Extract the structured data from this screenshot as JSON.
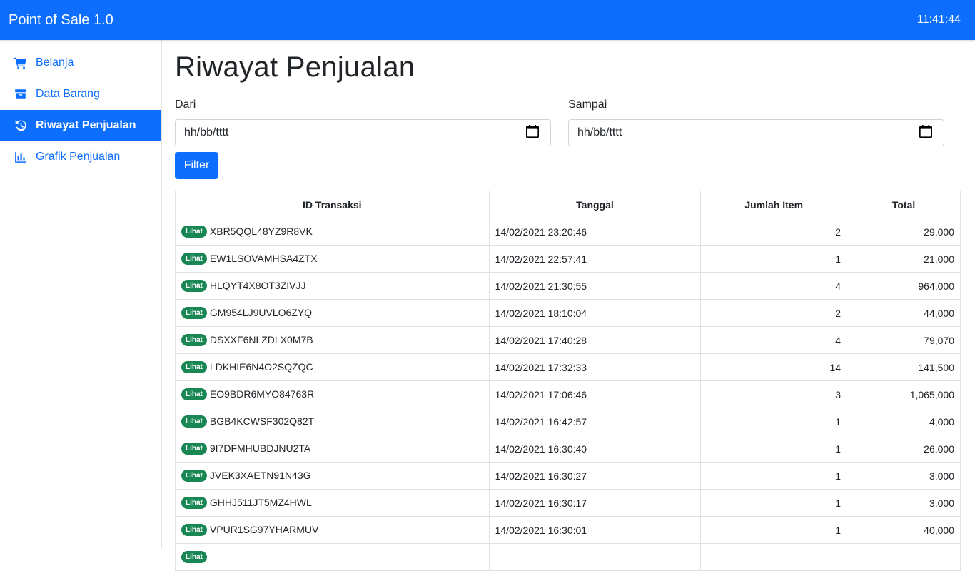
{
  "app": {
    "title": "Point of Sale 1.0",
    "clock": "11:41:44"
  },
  "sidebar": {
    "items": [
      {
        "label": "Belanja",
        "icon": "cart-icon"
      },
      {
        "label": "Data Barang",
        "icon": "archive-box-icon"
      },
      {
        "label": "Riwayat Penjualan",
        "icon": "history-icon",
        "active": true
      },
      {
        "label": "Grafik Penjualan",
        "icon": "bar-chart-icon"
      }
    ]
  },
  "main": {
    "title": "Riwayat Penjualan",
    "filter": {
      "from_label": "Dari",
      "from_value": "hh/bb/tttt",
      "to_label": "Sampai",
      "to_value": "hh/bb/tttt",
      "button_label": "Filter"
    },
    "table": {
      "headers": [
        "ID Transaksi",
        "Tanggal",
        "Jumlah Item",
        "Total"
      ],
      "view_label": "Lihat",
      "rows": [
        {
          "id": "XBR5QQL48YZ9R8VK",
          "date": "14/02/2021 23:20:46",
          "items": "2",
          "total": "29,000"
        },
        {
          "id": "EW1LSOVAMHSA4ZTX",
          "date": "14/02/2021 22:57:41",
          "items": "1",
          "total": "21,000"
        },
        {
          "id": "HLQYT4X8OT3ZIVJJ",
          "date": "14/02/2021 21:30:55",
          "items": "4",
          "total": "964,000"
        },
        {
          "id": "GM954LJ9UVLO6ZYQ",
          "date": "14/02/2021 18:10:04",
          "items": "2",
          "total": "44,000"
        },
        {
          "id": "DSXXF6NLZDLX0M7B",
          "date": "14/02/2021 17:40:28",
          "items": "4",
          "total": "79,070"
        },
        {
          "id": "LDKHIE6N4O2SQZQC",
          "date": "14/02/2021 17:32:33",
          "items": "14",
          "total": "141,500"
        },
        {
          "id": "EO9BDR6MYO84763R",
          "date": "14/02/2021 17:06:46",
          "items": "3",
          "total": "1,065,000"
        },
        {
          "id": "BGB4KCWSF302Q82T",
          "date": "14/02/2021 16:42:57",
          "items": "1",
          "total": "4,000"
        },
        {
          "id": "9I7DFMHUBDJNU2TA",
          "date": "14/02/2021 16:30:40",
          "items": "1",
          "total": "26,000"
        },
        {
          "id": "JVEK3XAETN91N43G",
          "date": "14/02/2021 16:30:27",
          "items": "1",
          "total": "3,000"
        },
        {
          "id": "GHHJ511JT5MZ4HWL",
          "date": "14/02/2021 16:30:17",
          "items": "1",
          "total": "3,000"
        },
        {
          "id": "VPUR1SG97YHARMUV",
          "date": "14/02/2021 16:30:01",
          "items": "1",
          "total": "40,000"
        },
        {
          "id": "",
          "date": "",
          "items": "",
          "total": ""
        }
      ]
    }
  },
  "colors": {
    "primary": "#0d6efd",
    "success": "#198754"
  }
}
